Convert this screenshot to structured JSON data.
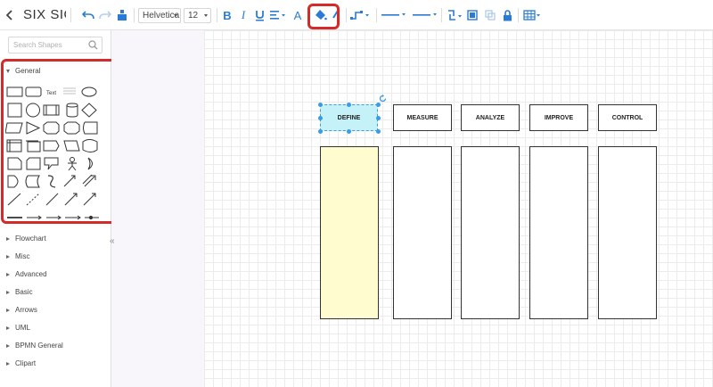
{
  "app": {
    "title": "SIX SIG"
  },
  "toolbar": {
    "font_family": "Helvetica",
    "font_size": "12",
    "icons": [
      "back-icon",
      "undo-icon",
      "redo-icon",
      "format-painter-icon",
      "bold-icon",
      "italic-icon",
      "underline-icon",
      "align-icon",
      "font-color-icon",
      "fill-color-icon",
      "line-color-icon",
      "connector-style-icon",
      "line-style-icon",
      "line-weight-icon",
      "arrange-icon",
      "to-front-icon",
      "to-back-icon",
      "lock-icon",
      "table-icon"
    ]
  },
  "sidebar": {
    "search_placeholder": "Search Shapes",
    "open_category": "General",
    "shape_text_label": "Text",
    "categories": [
      "Flowchart",
      "Misc",
      "Advanced",
      "Basic",
      "Arrows",
      "UML",
      "BPMN General",
      "Clipart"
    ]
  },
  "diagram": {
    "phases": [
      "DEFINE",
      "MEASURE",
      "ANALYZE",
      "IMPROVE",
      "CONTROL"
    ],
    "selected_phase": "DEFINE",
    "colors": {
      "selected_fill": "#c5f1f8",
      "selected_column_fill": "#fffdd0",
      "selection_handle": "#3a9be6"
    }
  },
  "colors": {
    "accent": "#2b7bd6",
    "highlight_box": "#d42a2a"
  }
}
